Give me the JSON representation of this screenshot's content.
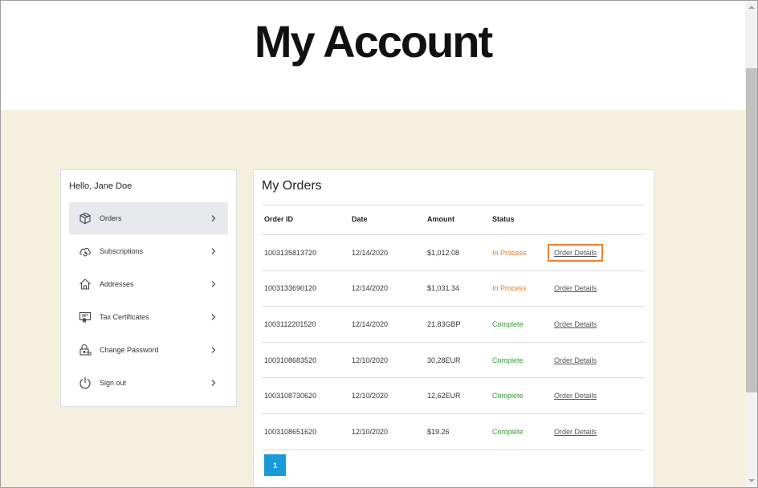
{
  "header": {
    "title": "My Account"
  },
  "sidebar": {
    "greeting": "Hello, Jane Doe",
    "items": [
      {
        "label": "Orders",
        "icon": "box-icon",
        "active": true
      },
      {
        "label": "Subscriptions",
        "icon": "cloud-refresh-icon",
        "active": false
      },
      {
        "label": "Addresses",
        "icon": "home-icon",
        "active": false
      },
      {
        "label": "Tax Certificates",
        "icon": "certificate-icon",
        "active": false
      },
      {
        "label": "Change Password",
        "icon": "lock-icon",
        "active": false
      },
      {
        "label": "Sign out",
        "icon": "power-icon",
        "active": false
      }
    ]
  },
  "orders": {
    "title": "My Orders",
    "columns": [
      "Order ID",
      "Date",
      "Amount",
      "Status",
      ""
    ],
    "rows": [
      {
        "id": "1003135813720",
        "date": "12/14/2020",
        "amount": "$1,012.08",
        "status": "In Process",
        "link": "Order Details"
      },
      {
        "id": "1003133690120",
        "date": "12/14/2020",
        "amount": "$1,031.34",
        "status": "In Process",
        "link": "Order Details"
      },
      {
        "id": "1003112201520",
        "date": "12/14/2020",
        "amount": "21.83GBP",
        "status": "Complete",
        "link": "Order Details"
      },
      {
        "id": "1003108683520",
        "date": "12/10/2020",
        "amount": "30,28EUR",
        "status": "Complete",
        "link": "Order Details"
      },
      {
        "id": "1003108730620",
        "date": "12/10/2020",
        "amount": "12,62EUR",
        "status": "Complete",
        "link": "Order Details"
      },
      {
        "id": "1003108651620",
        "date": "12/10/2020",
        "amount": "$19.26",
        "status": "Complete",
        "link": "Order Details"
      }
    ],
    "pagination": {
      "current_page": "1"
    }
  },
  "colors": {
    "page_bg": "#f5efdf",
    "in_process": "#e07b29",
    "complete": "#3a9a3a",
    "pager": "#1a9ad6",
    "highlight_outline": "#ee8134"
  }
}
